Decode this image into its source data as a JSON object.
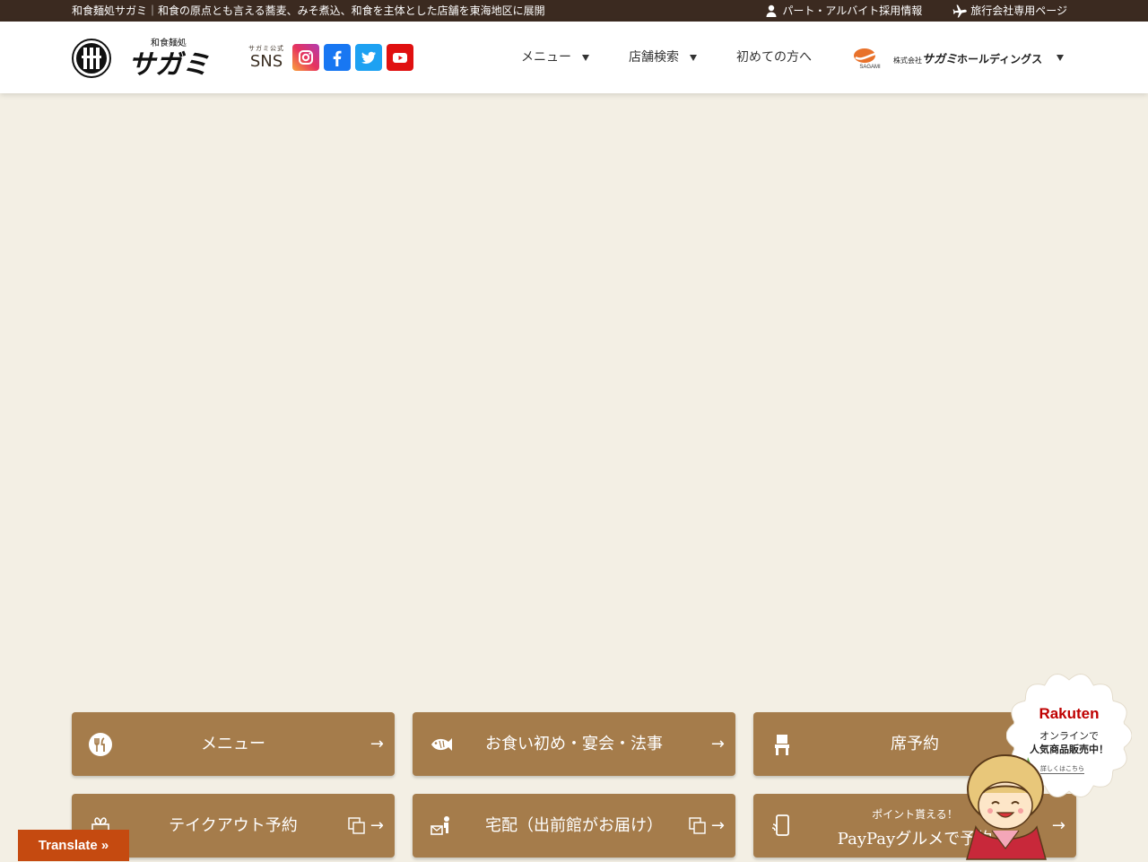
{
  "topbar": {
    "tagline": "和食麺処サガミ｜和食の原点とも言える蕎麦、みそ煮込、和食を主体とした店舗を東海地区に展開",
    "recruit_label": "パート・アルバイト採用情報",
    "travel_label": "旅行会社専用ページ"
  },
  "header": {
    "logo_sub": "和食麺処",
    "logo_main": "サガミ",
    "sns_small": "サガミ公式",
    "sns_big": "SNS",
    "sns_icons": [
      "instagram-icon",
      "facebook-icon",
      "twitter-icon",
      "youtube-icon"
    ],
    "nav": {
      "menu": "メニュー",
      "store_search": "店舗検索",
      "first_time": "初めての方へ"
    },
    "holdings": {
      "mark": "SAGAMI",
      "company": "株式会社",
      "name": "サガミ",
      "suffix": "ホールディングス"
    }
  },
  "buttons": [
    {
      "label": "メニュー",
      "icon": "fork-knife-icon"
    },
    {
      "label": "お食い初め・宴会・法事",
      "icon": "sea-bream-icon"
    },
    {
      "label": "席予約",
      "icon": "chair-icon"
    },
    {
      "label": "テイクアウト予約",
      "icon": "gift-icon"
    },
    {
      "label": "宅配（出前館がお届け）",
      "icon": "delivery-icon"
    },
    {
      "small": "ポイント貰える！",
      "label": "PayPayグルメで予約",
      "icon": "smartphone-icon"
    }
  ],
  "arrow": "→",
  "rakuten": {
    "logo": "Rakuten",
    "line1": "オンラインで",
    "line2": "人気商品販売中！",
    "line3": "詳しくはこちら"
  },
  "translate": "Translate »",
  "colors": {
    "topbar": "#3b2a20",
    "button": "#a57c4b",
    "background": "#f3efe4",
    "translate": "#c54a10"
  }
}
